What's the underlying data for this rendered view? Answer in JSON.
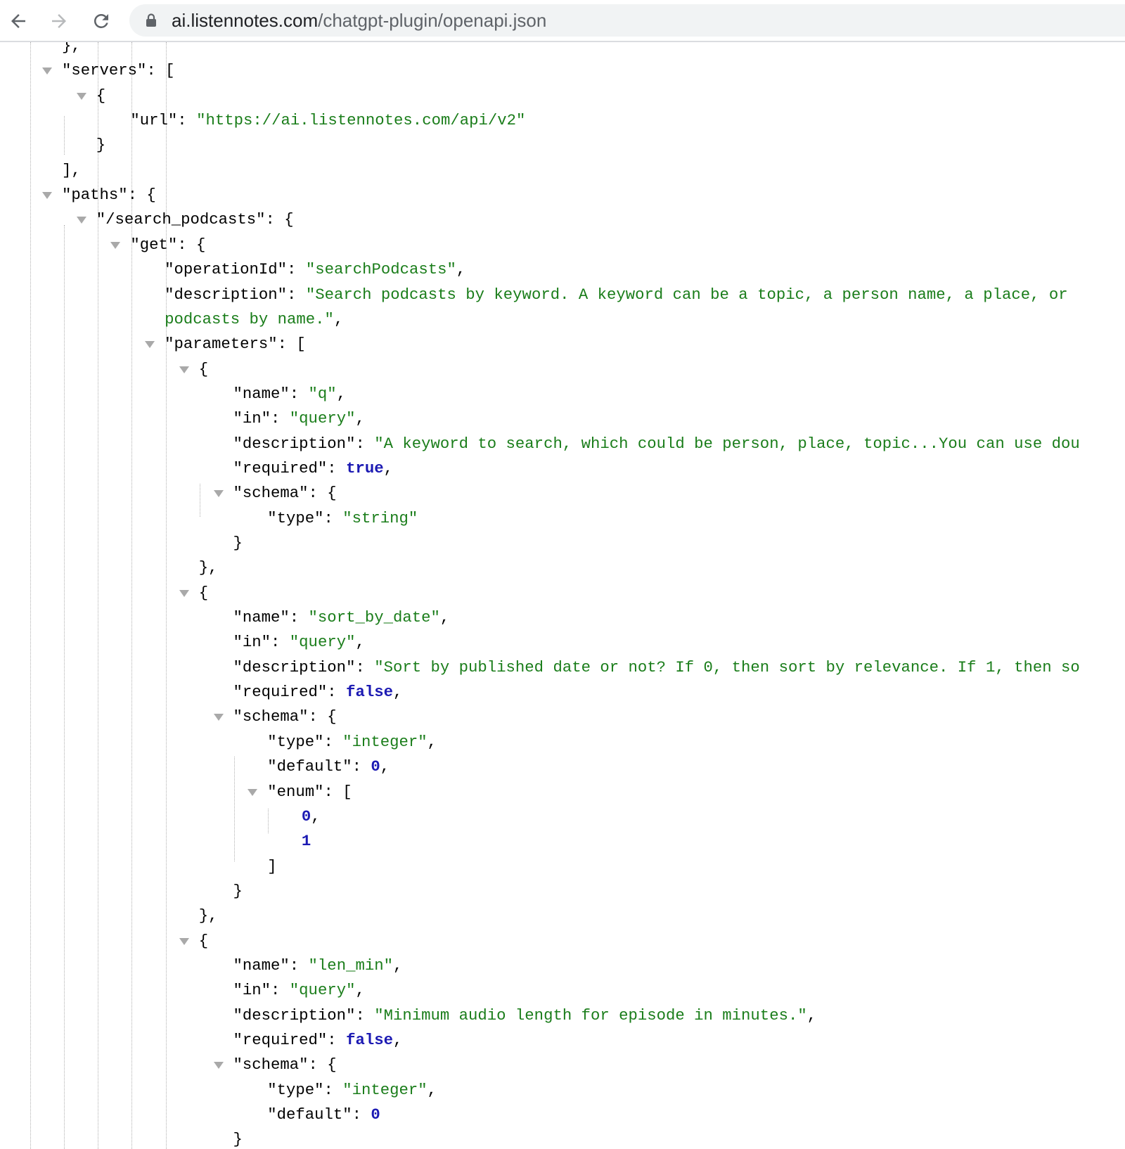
{
  "browser": {
    "url_host": "ai.listennotes.com",
    "url_path": "/chatgpt-plugin/openapi.json"
  },
  "json_lines": [
    {
      "indent": 0,
      "toggle": false,
      "parts": [
        {
          "t": "},",
          "c": "k"
        }
      ]
    },
    {
      "indent": 0,
      "toggle": true,
      "parts": [
        {
          "t": "\"servers\": [",
          "c": "k"
        }
      ]
    },
    {
      "indent": 1,
      "toggle": true,
      "parts": [
        {
          "t": "{",
          "c": "k"
        }
      ]
    },
    {
      "indent": 2,
      "toggle": false,
      "parts": [
        {
          "t": "\"url\": ",
          "c": "k"
        },
        {
          "t": "\"https://ai.listennotes.com/api/v2\"",
          "c": "s"
        }
      ]
    },
    {
      "indent": 1,
      "toggle": false,
      "parts": [
        {
          "t": "}",
          "c": "k"
        }
      ]
    },
    {
      "indent": 0,
      "toggle": false,
      "parts": [
        {
          "t": "],",
          "c": "k"
        }
      ]
    },
    {
      "indent": 0,
      "toggle": true,
      "parts": [
        {
          "t": "\"paths\": {",
          "c": "k"
        }
      ]
    },
    {
      "indent": 1,
      "toggle": true,
      "parts": [
        {
          "t": "\"/search_podcasts\": {",
          "c": "k"
        }
      ]
    },
    {
      "indent": 2,
      "toggle": true,
      "parts": [
        {
          "t": "\"get\": {",
          "c": "k"
        }
      ]
    },
    {
      "indent": 3,
      "toggle": false,
      "parts": [
        {
          "t": "\"operationId\": ",
          "c": "k"
        },
        {
          "t": "\"searchPodcasts\"",
          "c": "s"
        },
        {
          "t": ",",
          "c": "k"
        }
      ]
    },
    {
      "indent": 3,
      "toggle": false,
      "parts": [
        {
          "t": "\"description\": ",
          "c": "k"
        },
        {
          "t": "\"Search podcasts by keyword. A keyword can be a topic, a person name, a place, or",
          "c": "s"
        }
      ]
    },
    {
      "indent": 3,
      "toggle": false,
      "parts": [
        {
          "t": "podcasts by name.\"",
          "c": "s"
        },
        {
          "t": ",",
          "c": "k"
        }
      ]
    },
    {
      "indent": 3,
      "toggle": true,
      "parts": [
        {
          "t": "\"parameters\": [",
          "c": "k"
        }
      ]
    },
    {
      "indent": 4,
      "toggle": true,
      "parts": [
        {
          "t": "{",
          "c": "k"
        }
      ]
    },
    {
      "indent": 5,
      "toggle": false,
      "parts": [
        {
          "t": "\"name\": ",
          "c": "k"
        },
        {
          "t": "\"q\"",
          "c": "s"
        },
        {
          "t": ",",
          "c": "k"
        }
      ]
    },
    {
      "indent": 5,
      "toggle": false,
      "parts": [
        {
          "t": "\"in\": ",
          "c": "k"
        },
        {
          "t": "\"query\"",
          "c": "s"
        },
        {
          "t": ",",
          "c": "k"
        }
      ]
    },
    {
      "indent": 5,
      "toggle": false,
      "parts": [
        {
          "t": "\"description\": ",
          "c": "k"
        },
        {
          "t": "\"A keyword to search, which could be person, place, topic...You can use dou",
          "c": "s"
        }
      ]
    },
    {
      "indent": 5,
      "toggle": false,
      "parts": [
        {
          "t": "\"required\": ",
          "c": "k"
        },
        {
          "t": "true",
          "c": "kw"
        },
        {
          "t": ",",
          "c": "k"
        }
      ]
    },
    {
      "indent": 5,
      "toggle": true,
      "parts": [
        {
          "t": "\"schema\": {",
          "c": "k"
        }
      ]
    },
    {
      "indent": 6,
      "toggle": false,
      "parts": [
        {
          "t": "\"type\": ",
          "c": "k"
        },
        {
          "t": "\"string\"",
          "c": "s"
        }
      ]
    },
    {
      "indent": 5,
      "toggle": false,
      "parts": [
        {
          "t": "}",
          "c": "k"
        }
      ]
    },
    {
      "indent": 4,
      "toggle": false,
      "parts": [
        {
          "t": "},",
          "c": "k"
        }
      ]
    },
    {
      "indent": 4,
      "toggle": true,
      "parts": [
        {
          "t": "{",
          "c": "k"
        }
      ]
    },
    {
      "indent": 5,
      "toggle": false,
      "parts": [
        {
          "t": "\"name\": ",
          "c": "k"
        },
        {
          "t": "\"sort_by_date\"",
          "c": "s"
        },
        {
          "t": ",",
          "c": "k"
        }
      ]
    },
    {
      "indent": 5,
      "toggle": false,
      "parts": [
        {
          "t": "\"in\": ",
          "c": "k"
        },
        {
          "t": "\"query\"",
          "c": "s"
        },
        {
          "t": ",",
          "c": "k"
        }
      ]
    },
    {
      "indent": 5,
      "toggle": false,
      "parts": [
        {
          "t": "\"description\": ",
          "c": "k"
        },
        {
          "t": "\"Sort by published date or not? If 0, then sort by relevance. If 1, then so",
          "c": "s"
        }
      ]
    },
    {
      "indent": 5,
      "toggle": false,
      "parts": [
        {
          "t": "\"required\": ",
          "c": "k"
        },
        {
          "t": "false",
          "c": "kw"
        },
        {
          "t": ",",
          "c": "k"
        }
      ]
    },
    {
      "indent": 5,
      "toggle": true,
      "parts": [
        {
          "t": "\"schema\": {",
          "c": "k"
        }
      ]
    },
    {
      "indent": 6,
      "toggle": false,
      "parts": [
        {
          "t": "\"type\": ",
          "c": "k"
        },
        {
          "t": "\"integer\"",
          "c": "s"
        },
        {
          "t": ",",
          "c": "k"
        }
      ]
    },
    {
      "indent": 6,
      "toggle": false,
      "parts": [
        {
          "t": "\"default\": ",
          "c": "k"
        },
        {
          "t": "0",
          "c": "num"
        },
        {
          "t": ",",
          "c": "k"
        }
      ]
    },
    {
      "indent": 6,
      "toggle": true,
      "parts": [
        {
          "t": "\"enum\": [",
          "c": "k"
        }
      ]
    },
    {
      "indent": 7,
      "toggle": false,
      "parts": [
        {
          "t": "0",
          "c": "num"
        },
        {
          "t": ",",
          "c": "k"
        }
      ]
    },
    {
      "indent": 7,
      "toggle": false,
      "parts": [
        {
          "t": "1",
          "c": "num"
        }
      ]
    },
    {
      "indent": 6,
      "toggle": false,
      "parts": [
        {
          "t": "]",
          "c": "k"
        }
      ]
    },
    {
      "indent": 5,
      "toggle": false,
      "parts": [
        {
          "t": "}",
          "c": "k"
        }
      ]
    },
    {
      "indent": 4,
      "toggle": false,
      "parts": [
        {
          "t": "},",
          "c": "k"
        }
      ]
    },
    {
      "indent": 4,
      "toggle": true,
      "parts": [
        {
          "t": "{",
          "c": "k"
        }
      ]
    },
    {
      "indent": 5,
      "toggle": false,
      "parts": [
        {
          "t": "\"name\": ",
          "c": "k"
        },
        {
          "t": "\"len_min\"",
          "c": "s"
        },
        {
          "t": ",",
          "c": "k"
        }
      ]
    },
    {
      "indent": 5,
      "toggle": false,
      "parts": [
        {
          "t": "\"in\": ",
          "c": "k"
        },
        {
          "t": "\"query\"",
          "c": "s"
        },
        {
          "t": ",",
          "c": "k"
        }
      ]
    },
    {
      "indent": 5,
      "toggle": false,
      "parts": [
        {
          "t": "\"description\": ",
          "c": "k"
        },
        {
          "t": "\"Minimum audio length for episode in minutes.\"",
          "c": "s"
        },
        {
          "t": ",",
          "c": "k"
        }
      ]
    },
    {
      "indent": 5,
      "toggle": false,
      "parts": [
        {
          "t": "\"required\": ",
          "c": "k"
        },
        {
          "t": "false",
          "c": "kw"
        },
        {
          "t": ",",
          "c": "k"
        }
      ]
    },
    {
      "indent": 5,
      "toggle": true,
      "parts": [
        {
          "t": "\"schema\": {",
          "c": "k"
        }
      ]
    },
    {
      "indent": 6,
      "toggle": false,
      "parts": [
        {
          "t": "\"type\": ",
          "c": "k"
        },
        {
          "t": "\"integer\"",
          "c": "s"
        },
        {
          "t": ",",
          "c": "k"
        }
      ]
    },
    {
      "indent": 6,
      "toggle": false,
      "parts": [
        {
          "t": "\"default\": ",
          "c": "k"
        },
        {
          "t": "0",
          "c": "num"
        }
      ]
    },
    {
      "indent": 5,
      "toggle": false,
      "parts": [
        {
          "t": "}",
          "c": "k"
        }
      ]
    }
  ]
}
